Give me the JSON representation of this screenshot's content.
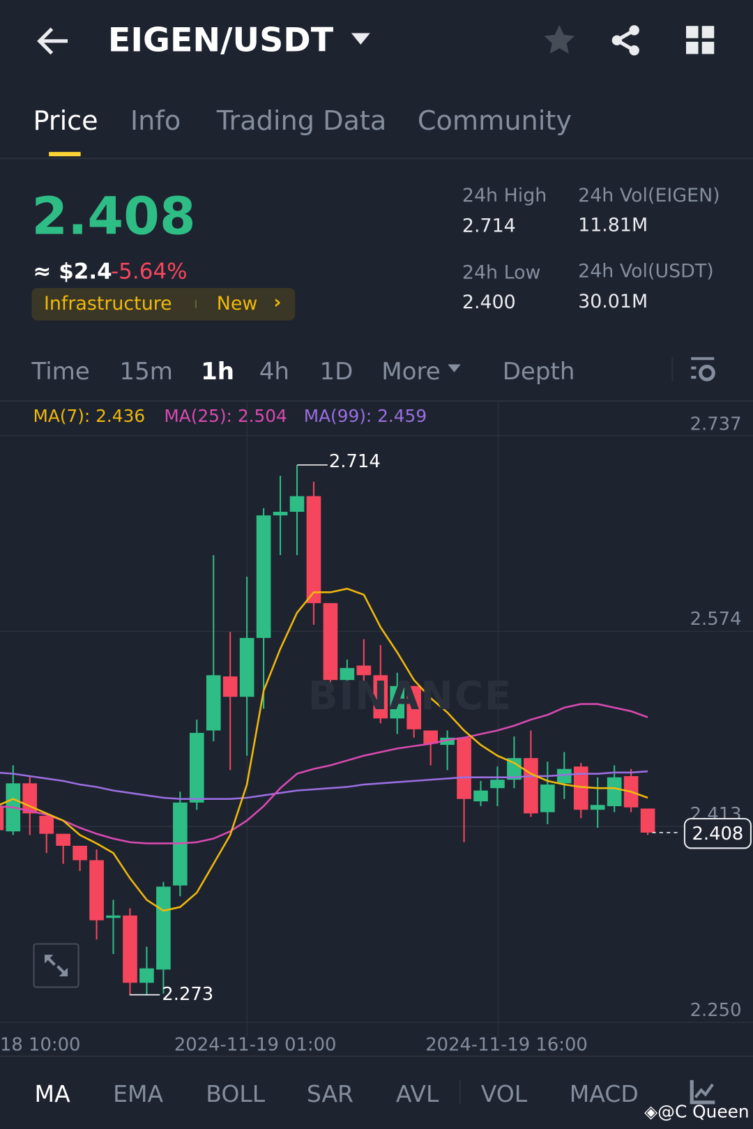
{
  "header": {
    "title": "EIGEN/USDT",
    "icons": [
      "back-arrow-icon",
      "dropdown-caret-icon",
      "star-icon",
      "share-icon",
      "grid-icon"
    ]
  },
  "tabs": [
    {
      "label": "Price",
      "active": true
    },
    {
      "label": "Info"
    },
    {
      "label": "Trading Data"
    },
    {
      "label": "Community"
    }
  ],
  "ticker": {
    "price": "2.408",
    "usd": "≈ $2.4",
    "change": "-5.64%",
    "tag": "Infrastructure",
    "tag2": "New",
    "stats": {
      "high_label": "24h High",
      "high": "2.714",
      "low_label": "24h Low",
      "low": "2.400",
      "vol_base_label": "24h Vol(EIGEN)",
      "vol_base": "11.81M",
      "vol_quote_label": "24h Vol(USDT)",
      "vol_quote": "30.01M"
    }
  },
  "intervals": {
    "items": [
      "Time",
      "15m",
      "1h",
      "4h",
      "1D"
    ],
    "active": "1h",
    "more": "More",
    "depth": "Depth"
  },
  "colors": {
    "up": "#2ebd85",
    "down": "#f6465d",
    "ma7": "#f0b90b",
    "ma25": "#d84bb0",
    "ma99": "#9a6fe0",
    "accent": "#fcd535"
  },
  "chart_data": {
    "type": "candlestick",
    "legend": {
      "ma7": "MA(7): 2.436",
      "ma25": "MA(25): 2.504",
      "ma99": "MA(99): 2.459"
    },
    "y_ticks": [
      "2.737",
      "2.574",
      "2.413",
      "2.250"
    ],
    "ylim": [
      2.25,
      2.737
    ],
    "x_ticks": [
      "18 10:00",
      "2024-11-19 01:00",
      "2024-11-19 16:00"
    ],
    "high_marker": "2.714",
    "low_marker": "2.273",
    "last_price": "2.408",
    "watermark": "BINANCE",
    "candles": [
      [
        2.43,
        2.436,
        2.4,
        2.41
      ],
      [
        2.409,
        2.464,
        2.406,
        2.449
      ],
      [
        2.449,
        2.455,
        2.406,
        2.424
      ],
      [
        2.422,
        2.424,
        2.391,
        2.407
      ],
      [
        2.407,
        2.407,
        2.382,
        2.397
      ],
      [
        2.397,
        2.397,
        2.376,
        2.385
      ],
      [
        2.385,
        2.394,
        2.319,
        2.335
      ],
      [
        2.337,
        2.352,
        2.307,
        2.339
      ],
      [
        2.339,
        2.345,
        2.273,
        2.283
      ],
      [
        2.283,
        2.313,
        2.273,
        2.295
      ],
      [
        2.294,
        2.367,
        2.274,
        2.363
      ],
      [
        2.364,
        2.442,
        2.355,
        2.433
      ],
      [
        2.433,
        2.502,
        2.427,
        2.491
      ],
      [
        2.493,
        2.639,
        2.484,
        2.539
      ],
      [
        2.538,
        2.575,
        2.46,
        2.521
      ],
      [
        2.521,
        2.621,
        2.472,
        2.57
      ],
      [
        2.57,
        2.678,
        2.511,
        2.672
      ],
      [
        2.672,
        2.705,
        2.639,
        2.675
      ],
      [
        2.675,
        2.714,
        2.639,
        2.688
      ],
      [
        2.688,
        2.7,
        2.581,
        2.599
      ],
      [
        2.599,
        2.599,
        2.529,
        2.535
      ],
      [
        2.535,
        2.552,
        2.532,
        2.545
      ],
      [
        2.547,
        2.569,
        2.532,
        2.539
      ],
      [
        2.539,
        2.564,
        2.499,
        2.503
      ],
      [
        2.503,
        2.541,
        2.49,
        2.53
      ],
      [
        2.53,
        2.53,
        2.487,
        2.494
      ],
      [
        2.493,
        2.493,
        2.464,
        2.482
      ],
      [
        2.481,
        2.493,
        2.46,
        2.487
      ],
      [
        2.487,
        2.487,
        2.4,
        2.436
      ],
      [
        2.434,
        2.451,
        2.43,
        2.443
      ],
      [
        2.445,
        2.463,
        2.43,
        2.452
      ],
      [
        2.452,
        2.488,
        2.445,
        2.47
      ],
      [
        2.47,
        2.493,
        2.421,
        2.424
      ],
      [
        2.425,
        2.467,
        2.415,
        2.448
      ],
      [
        2.449,
        2.475,
        2.436,
        2.461
      ],
      [
        2.463,
        2.466,
        2.42,
        2.427
      ],
      [
        2.427,
        2.454,
        2.412,
        2.431
      ],
      [
        2.43,
        2.464,
        2.425,
        2.454
      ],
      [
        2.455,
        2.461,
        2.425,
        2.429
      ],
      [
        2.428,
        2.428,
        2.406,
        2.408
      ]
    ],
    "ma7": [
      2.43,
      2.436,
      2.43,
      2.424,
      2.418,
      2.406,
      2.399,
      2.391,
      2.37,
      2.352,
      2.343,
      2.346,
      2.358,
      2.382,
      2.406,
      2.448,
      2.526,
      2.561,
      2.591,
      2.608,
      2.608,
      2.611,
      2.606,
      2.579,
      2.558,
      2.535,
      2.52,
      2.508,
      2.493,
      2.481,
      2.472,
      2.466,
      2.457,
      2.451,
      2.448,
      2.446,
      2.445,
      2.445,
      2.442,
      2.437
    ],
    "ma25": [
      2.43,
      2.429,
      2.426,
      2.423,
      2.418,
      2.412,
      2.407,
      2.403,
      2.4,
      2.399,
      2.399,
      2.399,
      2.4,
      2.403,
      2.409,
      2.418,
      2.43,
      2.445,
      2.457,
      2.461,
      2.464,
      2.468,
      2.472,
      2.475,
      2.478,
      2.48,
      2.482,
      2.485,
      2.487,
      2.49,
      2.493,
      2.497,
      2.502,
      2.506,
      2.512,
      2.515,
      2.515,
      2.512,
      2.509,
      2.504
    ],
    "ma99": [
      2.458,
      2.457,
      2.455,
      2.453,
      2.451,
      2.448,
      2.446,
      2.443,
      2.441,
      2.439,
      2.437,
      2.436,
      2.436,
      2.436,
      2.436,
      2.437,
      2.439,
      2.441,
      2.443,
      2.444,
      2.445,
      2.446,
      2.448,
      2.449,
      2.45,
      2.451,
      2.452,
      2.453,
      2.454,
      2.454,
      2.454,
      2.454,
      2.455,
      2.455,
      2.456,
      2.457,
      2.457,
      2.458,
      2.458,
      2.459
    ]
  },
  "indicators": {
    "main": [
      "MA",
      "EMA",
      "BOLL",
      "SAR",
      "AVL"
    ],
    "sub": [
      "VOL",
      "MACD"
    ],
    "active": "MA"
  },
  "credit": "@C Queen"
}
